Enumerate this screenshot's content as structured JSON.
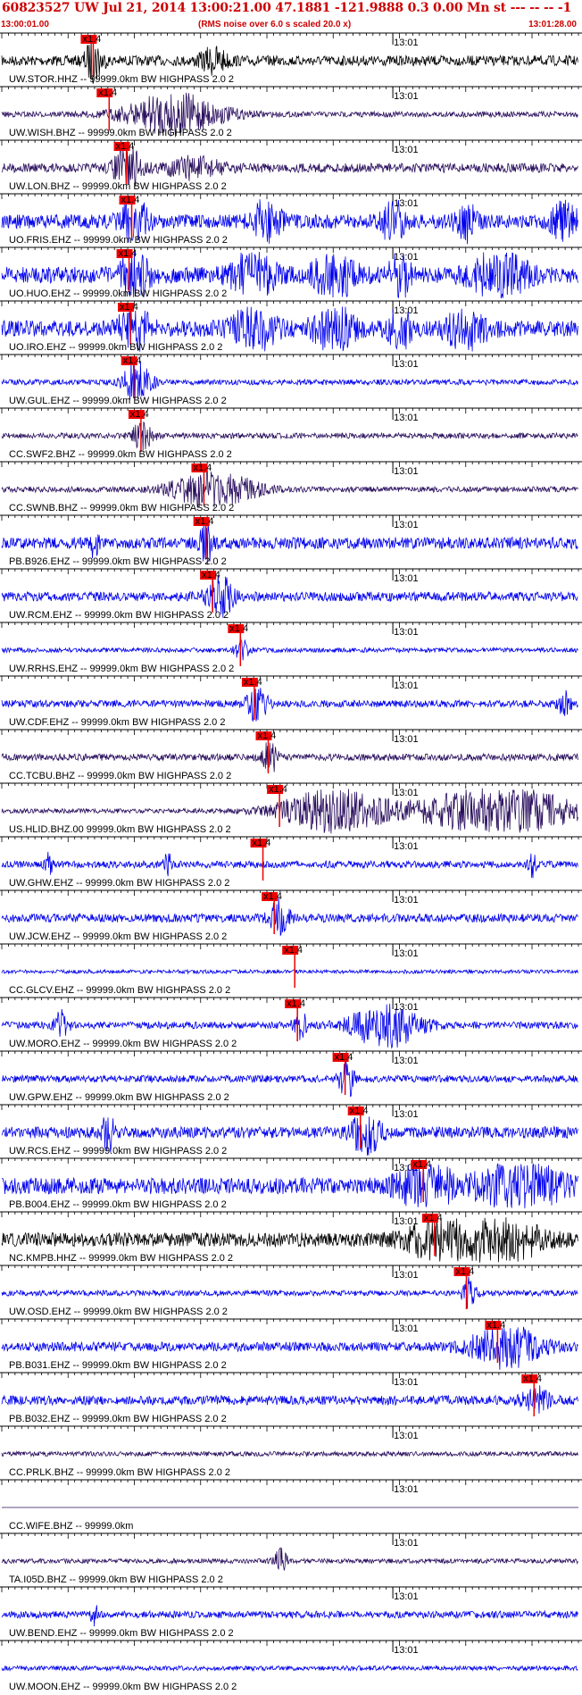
{
  "header": {
    "title": "60823527 UW Jul 21, 2014 13:00:21.00   47.1881 -121.9888  0.3 0.00 Mn st --- -- --  -1",
    "start_time": "13:00:01.00",
    "subtitle": "(RMS noise over 6.0 s scaled 20.0 x)",
    "end_time": "13:01:28.00"
  },
  "colors": {
    "header_text": "#cc0000",
    "trace_blue": "#0000ee",
    "trace_purple": "#2a0f5e",
    "trace_black": "#000000",
    "pick_flag": "#ee0000",
    "line": "#000000"
  },
  "chart_data": {
    "type": "line",
    "title": "60823527 UW Jul 21, 2014 13:00:21.00   47.1881 -121.9888  0.3 0.00 Mn st --- -- --  -1",
    "time_axis": {
      "start": "13:00:01.00",
      "end": "13:01:28.00",
      "minute_label": "13:01",
      "minute_mark_seconds": 59
    },
    "series": [
      {
        "name": "UW.STOR.HHZ.--",
        "label": "UW.STOR.HHZ -- 99999.0km BW  HIGHPASS  2.0  2",
        "color": "black",
        "pick_seconds": 13.8,
        "pick_label": "x1.4",
        "noise": 0.22,
        "bursts": [
          [
            13.9,
            1.2,
            1.0
          ],
          [
            32,
            2,
            0.5
          ]
        ]
      },
      {
        "name": "UW.WISH.BHZ.--",
        "label": "UW.WISH.BHZ -- 99999.0km BW  HIGHPASS  2.0  2",
        "color": "purple",
        "pick_seconds": 16.2,
        "pick_label": "x1.4",
        "noise": 0.12,
        "bursts": [
          [
            26,
            7,
            0.9
          ]
        ]
      },
      {
        "name": "UW.LON.BHZ.--",
        "label": "UW.LON.BHZ -- 99999.0km BW  HIGHPASS  2.0  2",
        "color": "purple",
        "pick_seconds": 18.8,
        "pick_label": "x1.4",
        "noise": 0.2,
        "bursts": [
          [
            19,
            2,
            0.9
          ],
          [
            29,
            4,
            0.4
          ]
        ]
      },
      {
        "name": "UO.FRIS.EHZ.--",
        "label": "UO.FRIS.EHZ -- 99999.0km BW  HIGHPASS  2.0  2",
        "color": "blue",
        "pick_seconds": 19.6,
        "pick_label": "x1.4",
        "noise": 0.3,
        "bursts": [
          [
            20,
            2,
            1.0
          ],
          [
            40,
            2,
            0.9
          ],
          [
            59,
            1.5,
            1.0
          ],
          [
            70,
            1.5,
            0.8
          ],
          [
            85,
            2,
            0.8
          ]
        ]
      },
      {
        "name": "UO.HUO.EHZ.--",
        "label": "UO.HUO.EHZ -- 99999.0km BW  HIGHPASS  2.0  2",
        "color": "blue",
        "pick_seconds": 19.2,
        "pick_label": "x1.4",
        "noise": 0.35,
        "bursts": [
          [
            20,
            2,
            1.0
          ],
          [
            38,
            3,
            1.0
          ],
          [
            50,
            3,
            1.0
          ],
          [
            60,
            1.5,
            1.0
          ],
          [
            75,
            4,
            0.9
          ]
        ]
      },
      {
        "name": "UO.IRO.EHZ.--",
        "label": "UO.IRO.EHZ -- 99999.0km BW  HIGHPASS  2.0  2",
        "color": "blue",
        "pick_seconds": 19.4,
        "pick_label": "x1.4",
        "noise": 0.35,
        "bursts": [
          [
            20,
            2,
            1.0
          ],
          [
            38,
            3,
            1.0
          ],
          [
            50,
            3,
            1.0
          ],
          [
            60,
            1.5,
            1.0
          ],
          [
            70,
            3,
            0.8
          ]
        ]
      },
      {
        "name": "UW.GUL.EHZ.--",
        "label": "UW.GUL.EHZ -- 99999.0km BW  HIGHPASS  2.0  2",
        "color": "blue",
        "pick_seconds": 19.9,
        "pick_label": "x1.4",
        "noise": 0.12,
        "bursts": [
          [
            20.5,
            2,
            1.0
          ]
        ]
      },
      {
        "name": "CC.SWF2.BHZ.--",
        "label": "CC.SWF2.BHZ -- 99999.0km BW  HIGHPASS  2.0  2",
        "color": "purple",
        "pick_seconds": 21.0,
        "pick_label": "x1.4",
        "noise": 0.12,
        "bursts": [
          [
            21.2,
            1.5,
            0.6
          ]
        ]
      },
      {
        "name": "CC.SWNB.BHZ.--",
        "label": "CC.SWNB.BHZ -- 99999.0km BW  HIGHPASS  2.0  2",
        "color": "purple",
        "pick_seconds": 30.5,
        "pick_label": "x1.4",
        "noise": 0.12,
        "bursts": [
          [
            32,
            6,
            0.8
          ]
        ]
      },
      {
        "name": "PB.B926.EHZ.--",
        "label": "PB.B926.EHZ -- 99999.0km BW  HIGHPASS  2.0  2",
        "color": "blue",
        "pick_seconds": 30.8,
        "pick_label": "x1.4",
        "noise": 0.25,
        "bursts": [
          [
            14,
            0.5,
            0.8
          ],
          [
            31,
            1,
            0.9
          ]
        ]
      },
      {
        "name": "UW.RCM.EHZ.--",
        "label": "UW.RCM.EHZ -- 99999.0km BW  HIGHPASS  2.0  2",
        "color": "blue",
        "pick_seconds": 31.8,
        "pick_label": "x1.4",
        "noise": 0.2,
        "bursts": [
          [
            33,
            2,
            0.8
          ]
        ]
      },
      {
        "name": "UW.RRHS.EHZ.--",
        "label": "UW.RRHS.EHZ -- 99999.0km BW  HIGHPASS  2.0  2",
        "color": "blue",
        "pick_seconds": 36.0,
        "pick_label": "x1.4",
        "noise": 0.1,
        "bursts": [
          [
            36.2,
            1,
            0.5
          ]
        ]
      },
      {
        "name": "UW.CDF.EHZ.--",
        "label": "UW.CDF.EHZ -- 99999.0km BW  HIGHPASS  2.0  2",
        "color": "blue",
        "pick_seconds": 38.1,
        "pick_label": "x1.4",
        "noise": 0.15,
        "bursts": [
          [
            38.5,
            1.5,
            0.7
          ],
          [
            85,
            1,
            0.5
          ]
        ]
      },
      {
        "name": "CC.TCBU.BHZ.--",
        "label": "CC.TCBU.BHZ -- 99999.0km BW  HIGHPASS  2.0  2",
        "color": "purple",
        "pick_seconds": 40.2,
        "pick_label": "x1.4",
        "noise": 0.15,
        "bursts": [
          [
            40.4,
            1,
            0.8
          ]
        ]
      },
      {
        "name": "US.HLID.BHZ.00",
        "label": "US.HLID.BHZ.00 99999.0km BW  HIGHPASS  2.0  2",
        "color": "purple",
        "pick_seconds": 41.9,
        "pick_label": "x1.4",
        "noise": 0.1,
        "bursts": [
          [
            50,
            8,
            0.9
          ],
          [
            75,
            12,
            1.0
          ]
        ]
      },
      {
        "name": "UW.GHW.EHZ.--",
        "label": "UW.GHW.EHZ -- 99999.0km BW  HIGHPASS  2.0  2",
        "color": "blue",
        "pick_seconds": 39.4,
        "pick_label": "x1.4",
        "noise": 0.15,
        "bursts": [
          [
            7,
            0.5,
            0.8
          ],
          [
            25,
            0.5,
            0.6
          ],
          [
            80,
            0.5,
            0.6
          ]
        ]
      },
      {
        "name": "UW.JCW.EHZ.--",
        "label": "UW.JCW.EHZ -- 99999.0km BW  HIGHPASS  2.0  2",
        "color": "blue",
        "pick_seconds": 41.1,
        "pick_label": "x1.4",
        "noise": 0.18,
        "bursts": [
          [
            42,
            1.5,
            0.8
          ]
        ]
      },
      {
        "name": "CC.GLCV.EHZ.--",
        "label": "CC.GLCV.EHZ -- 99999.0km BW  HIGHPASS  2.0  2",
        "color": "blue",
        "pick_seconds": 44.2,
        "pick_label": "x1.4",
        "noise": 0.08,
        "bursts": []
      },
      {
        "name": "UW.MORO.EHZ.--",
        "label": "UW.MORO.EHZ -- 99999.0km BW  HIGHPASS  2.0  2",
        "color": "blue",
        "pick_seconds": 44.6,
        "pick_label": "x1.4",
        "noise": 0.15,
        "bursts": [
          [
            9,
            1,
            0.6
          ],
          [
            45,
            1,
            0.6
          ],
          [
            58,
            5,
            1.0
          ]
        ]
      },
      {
        "name": "UW.GPW.EHZ.--",
        "label": "UW.GPW.EHZ -- 99999.0km BW  HIGHPASS  2.0  2",
        "color": "blue",
        "pick_seconds": 51.8,
        "pick_label": "x1.4",
        "noise": 0.15,
        "bursts": [
          [
            52,
            1,
            1.0
          ]
        ]
      },
      {
        "name": "UW.RCS.EHZ.--",
        "label": "UW.RCS.EHZ -- 99999.0km BW  HIGHPASS  2.0  2",
        "color": "blue",
        "pick_seconds": 54.1,
        "pick_label": "x1.4",
        "noise": 0.25,
        "bursts": [
          [
            16,
            1,
            0.8
          ],
          [
            55,
            2,
            1.0
          ]
        ]
      },
      {
        "name": "PB.B004.EHZ.--",
        "label": "PB.B004.EHZ -- 99999.0km BW  HIGHPASS  2.0  2",
        "color": "blue",
        "pick_seconds": 63.6,
        "pick_label": "x1.4",
        "noise": 0.35,
        "bursts": [
          [
            64,
            4,
            0.9
          ],
          [
            78,
            6,
            1.0
          ]
        ]
      },
      {
        "name": "NC.KMPB.HHZ.--",
        "label": "NC.KMPB.HHZ -- 99999.0km BW  HIGHPASS  2.0  2",
        "color": "black",
        "pick_seconds": 65.3,
        "pick_label": "x1.4",
        "noise": 0.3,
        "bursts": [
          [
            66,
            5,
            0.9
          ],
          [
            76,
            5,
            0.9
          ]
        ]
      },
      {
        "name": "UW.OSD.EHZ.--",
        "label": "UW.OSD.EHZ -- 99999.0km BW  HIGHPASS  2.0  2",
        "color": "blue",
        "pick_seconds": 70.1,
        "pick_label": "x1.4",
        "noise": 0.12,
        "bursts": [
          [
            70.5,
            1,
            0.6
          ]
        ]
      },
      {
        "name": "PB.B031.EHZ.--",
        "label": "PB.B031.EHZ -- 99999.0km BW  HIGHPASS  2.0  2",
        "color": "blue",
        "pick_seconds": 74.8,
        "pick_label": "x1.4",
        "noise": 0.2,
        "bursts": [
          [
            76,
            5,
            0.9
          ]
        ]
      },
      {
        "name": "PB.B032.EHZ.--",
        "label": "PB.B032.EHZ -- 99999.0km BW  HIGHPASS  2.0  2",
        "color": "blue",
        "pick_seconds": 80.3,
        "pick_label": "x1.4",
        "noise": 0.2,
        "bursts": [
          [
            80.5,
            2,
            0.5
          ]
        ]
      },
      {
        "name": "CC.PRLK.BHZ.--",
        "label": "CC.PRLK.BHZ -- 99999.0km BW  HIGHPASS  2.0  2",
        "color": "purple",
        "pick_seconds": null,
        "pick_label": "",
        "noise": 0.1,
        "bursts": []
      },
      {
        "name": "CC.WIFE.BHZ.--",
        "label": "CC.WIFE.BHZ -- 99999.0km",
        "color": "purple",
        "pick_seconds": null,
        "pick_label": "",
        "noise": 0.0,
        "bursts": []
      },
      {
        "name": "TA.I05D.BHZ.--",
        "label": "TA.I05D.BHZ -- 99999.0km BW  HIGHPASS  2.0  2",
        "color": "purple",
        "pick_seconds": null,
        "pick_label": "",
        "noise": 0.1,
        "bursts": [
          [
            42,
            1,
            0.5
          ]
        ]
      },
      {
        "name": "UW.BEND.EHZ.--",
        "label": "UW.BEND.EHZ -- 99999.0km BW  HIGHPASS  2.0  2",
        "color": "blue",
        "pick_seconds": null,
        "pick_label": "",
        "noise": 0.15,
        "bursts": [
          [
            14,
            0.5,
            0.5
          ]
        ]
      },
      {
        "name": "UW.MOON.EHZ.--",
        "label": "UW.MOON.EHZ -- 99999.0km BW  HIGHPASS  2.0  2",
        "color": "blue",
        "pick_seconds": null,
        "pick_label": "",
        "noise": 0.1,
        "bursts": []
      }
    ]
  }
}
